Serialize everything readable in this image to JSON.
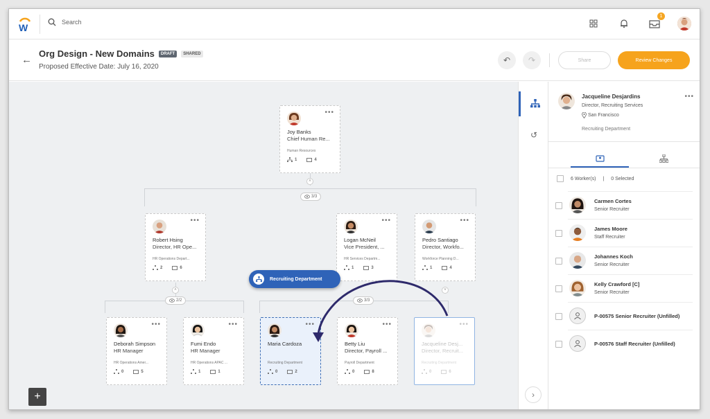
{
  "topbar": {
    "search_placeholder": "Search",
    "inbox_badge": "1"
  },
  "header": {
    "title": "Org Design - New Domains",
    "tag_draft": "DRAFT",
    "tag_shared": "SHARED",
    "subtitle": "Proposed Effective Date: July 16, 2020",
    "share_label": "Share",
    "review_label": "Review Changes"
  },
  "org": {
    "root": {
      "name": "Joy Banks",
      "title": "Chief Human Re...",
      "dept": "Human Resources",
      "c1": "1",
      "c2": "4"
    },
    "root_pill": "3/3",
    "level2": [
      {
        "name": "Robert Hsing",
        "title": "Director, HR Ope...",
        "dept": "HR Operations Depart...",
        "c1": "2",
        "c2": "6"
      },
      {
        "name": "Logan McNeil",
        "title": "Vice President, ...",
        "dept": "HR Services Departm...",
        "c1": "1",
        "c2": "3"
      },
      {
        "name": "Pedro Santiago",
        "title": "Director, Workfo...",
        "dept": "Workforce Planning D...",
        "c1": "1",
        "c2": "4"
      }
    ],
    "robert_pill": "2/2",
    "logan_pill": "3/3",
    "level3": [
      {
        "name": "Deborah Simpson",
        "title": "HR Manager",
        "dept": "HR Operations Amer...",
        "c1": "0",
        "c2": "5"
      },
      {
        "name": "Fumi Endo",
        "title": "HR Manager",
        "dept": "HR Operations APAC ...",
        "c1": "1",
        "c2": "1"
      },
      {
        "name": "Maria Cardoza",
        "title": "",
        "dept": "Recruiting Department",
        "c1": "0",
        "c2": "2"
      },
      {
        "name": "Betty Liu",
        "title": "Director, Payroll ...",
        "dept": "Payroll Department",
        "c1": "0",
        "c2": "8"
      },
      {
        "name": "Jacqueline Desj...",
        "title": "Director, Recruit...",
        "dept": "Recruiting Department",
        "c1": "0",
        "c2": "6"
      }
    ],
    "drag_label": "Recruiting Department"
  },
  "panel": {
    "name": "Jacqueline Desjardins",
    "title": "Director, Recruiting Services",
    "location": "San Francisco",
    "dept": "Recruiting Department",
    "workers": "6 Worker(s)",
    "selected": "0 Selected",
    "sep": "|",
    "list": [
      {
        "name": "Carmen Cortes",
        "title": "Senior Recruiter"
      },
      {
        "name": "James Moore",
        "title": "Staff Recruiter"
      },
      {
        "name": "Johannes Koch",
        "title": "Senior Recruiter"
      },
      {
        "name": "Kelly Crawford [C]",
        "title": "Senior Recruiter"
      },
      {
        "name": "P-00575 Senior Recruiter (Unfilled)",
        "title": ""
      },
      {
        "name": "P-00576 Staff Recruiter (Unfilled)",
        "title": ""
      }
    ]
  },
  "colors": {
    "accent": "#2f63b8",
    "primary_button": "#f6a31c"
  }
}
